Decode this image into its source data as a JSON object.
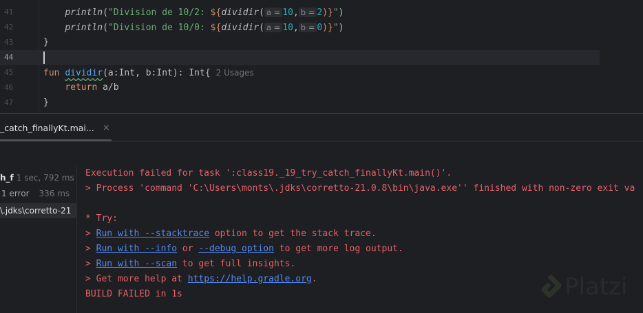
{
  "editor": {
    "line_numbers": [
      "41",
      "42",
      "43",
      "44",
      "45",
      "46",
      "47"
    ],
    "line41": {
      "fn": "println",
      "open": "(",
      "str": "\"Division de 10/2: ",
      "tpl_open": "${",
      "call": "dividir",
      "paren": "(",
      "hint_a": "a =",
      "a": "10",
      "comma": ",",
      "hint_b": "b =",
      "b": "2",
      "close": ")}",
      "str_end": "\"",
      ")": ")"
    },
    "line42": {
      "fn": "println",
      "open": "(",
      "str": "\"Division de 10/0: ",
      "tpl_open": "${",
      "call": "dividir",
      "paren": "(",
      "hint_a": "a =",
      "a": "10",
      "comma": ",",
      "hint_b": "b =",
      "b": "0",
      "close": ")}",
      "str_end": "\"",
      ")": ")"
    },
    "line43": "}",
    "line45": {
      "kw": "fun",
      "name": "dividir",
      "sig": "(a:Int, b:Int): Int{",
      "usages": "2 Usages"
    },
    "line46": {
      "kw": "return",
      "expr": "a/b"
    },
    "line47": "}"
  },
  "run_tab": {
    "label": "_catch_finallyKt.mai...",
    "close": "×"
  },
  "tree": [
    {
      "label": "h_f",
      "meta": "1 sec, 792 ms"
    },
    {
      "label": "1 error",
      "meta": "336 ms"
    },
    {
      "label": "\\.jdks\\corretto-21"
    }
  ],
  "console": {
    "l1": "Execution failed for task ':class19._19_try_catch_finallyKt.main()'.",
    "l2": "> Process 'command 'C:\\Users\\monts\\.jdks\\corretto-21.0.8\\bin\\java.exe'' finished with non-zero exit va",
    "l3": "* Try:",
    "l4": {
      "pre": "> ",
      "link": "Run with --stacktrace",
      "post": " option to get the stack trace."
    },
    "l5": {
      "pre": "> ",
      "link": "Run with --info",
      "mid": " or ",
      "link2": "--debug option",
      "post": " to get more log output."
    },
    "l6": {
      "pre": "> ",
      "link": "Run with --scan",
      "post": " to get full insights."
    },
    "l7": {
      "pre": "> Get more help at ",
      "link": "https://help.gradle.org",
      "post": "."
    },
    "l8": "BUILD FAILED in 1s"
  },
  "watermark": "Platzi"
}
